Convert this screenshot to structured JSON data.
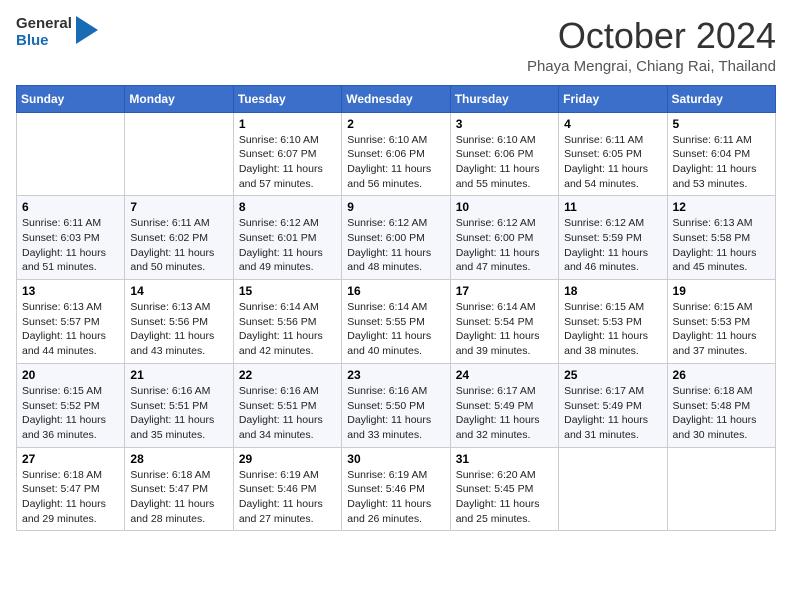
{
  "header": {
    "logo_general": "General",
    "logo_blue": "Blue",
    "month": "October 2024",
    "location": "Phaya Mengrai, Chiang Rai, Thailand"
  },
  "weekdays": [
    "Sunday",
    "Monday",
    "Tuesday",
    "Wednesday",
    "Thursday",
    "Friday",
    "Saturday"
  ],
  "weeks": [
    [
      {
        "day": "",
        "lines": []
      },
      {
        "day": "",
        "lines": []
      },
      {
        "day": "1",
        "lines": [
          "Sunrise: 6:10 AM",
          "Sunset: 6:07 PM",
          "Daylight: 11 hours",
          "and 57 minutes."
        ]
      },
      {
        "day": "2",
        "lines": [
          "Sunrise: 6:10 AM",
          "Sunset: 6:06 PM",
          "Daylight: 11 hours",
          "and 56 minutes."
        ]
      },
      {
        "day": "3",
        "lines": [
          "Sunrise: 6:10 AM",
          "Sunset: 6:06 PM",
          "Daylight: 11 hours",
          "and 55 minutes."
        ]
      },
      {
        "day": "4",
        "lines": [
          "Sunrise: 6:11 AM",
          "Sunset: 6:05 PM",
          "Daylight: 11 hours",
          "and 54 minutes."
        ]
      },
      {
        "day": "5",
        "lines": [
          "Sunrise: 6:11 AM",
          "Sunset: 6:04 PM",
          "Daylight: 11 hours",
          "and 53 minutes."
        ]
      }
    ],
    [
      {
        "day": "6",
        "lines": [
          "Sunrise: 6:11 AM",
          "Sunset: 6:03 PM",
          "Daylight: 11 hours",
          "and 51 minutes."
        ]
      },
      {
        "day": "7",
        "lines": [
          "Sunrise: 6:11 AM",
          "Sunset: 6:02 PM",
          "Daylight: 11 hours",
          "and 50 minutes."
        ]
      },
      {
        "day": "8",
        "lines": [
          "Sunrise: 6:12 AM",
          "Sunset: 6:01 PM",
          "Daylight: 11 hours",
          "and 49 minutes."
        ]
      },
      {
        "day": "9",
        "lines": [
          "Sunrise: 6:12 AM",
          "Sunset: 6:00 PM",
          "Daylight: 11 hours",
          "and 48 minutes."
        ]
      },
      {
        "day": "10",
        "lines": [
          "Sunrise: 6:12 AM",
          "Sunset: 6:00 PM",
          "Daylight: 11 hours",
          "and 47 minutes."
        ]
      },
      {
        "day": "11",
        "lines": [
          "Sunrise: 6:12 AM",
          "Sunset: 5:59 PM",
          "Daylight: 11 hours",
          "and 46 minutes."
        ]
      },
      {
        "day": "12",
        "lines": [
          "Sunrise: 6:13 AM",
          "Sunset: 5:58 PM",
          "Daylight: 11 hours",
          "and 45 minutes."
        ]
      }
    ],
    [
      {
        "day": "13",
        "lines": [
          "Sunrise: 6:13 AM",
          "Sunset: 5:57 PM",
          "Daylight: 11 hours",
          "and 44 minutes."
        ]
      },
      {
        "day": "14",
        "lines": [
          "Sunrise: 6:13 AM",
          "Sunset: 5:56 PM",
          "Daylight: 11 hours",
          "and 43 minutes."
        ]
      },
      {
        "day": "15",
        "lines": [
          "Sunrise: 6:14 AM",
          "Sunset: 5:56 PM",
          "Daylight: 11 hours",
          "and 42 minutes."
        ]
      },
      {
        "day": "16",
        "lines": [
          "Sunrise: 6:14 AM",
          "Sunset: 5:55 PM",
          "Daylight: 11 hours",
          "and 40 minutes."
        ]
      },
      {
        "day": "17",
        "lines": [
          "Sunrise: 6:14 AM",
          "Sunset: 5:54 PM",
          "Daylight: 11 hours",
          "and 39 minutes."
        ]
      },
      {
        "day": "18",
        "lines": [
          "Sunrise: 6:15 AM",
          "Sunset: 5:53 PM",
          "Daylight: 11 hours",
          "and 38 minutes."
        ]
      },
      {
        "day": "19",
        "lines": [
          "Sunrise: 6:15 AM",
          "Sunset: 5:53 PM",
          "Daylight: 11 hours",
          "and 37 minutes."
        ]
      }
    ],
    [
      {
        "day": "20",
        "lines": [
          "Sunrise: 6:15 AM",
          "Sunset: 5:52 PM",
          "Daylight: 11 hours",
          "and 36 minutes."
        ]
      },
      {
        "day": "21",
        "lines": [
          "Sunrise: 6:16 AM",
          "Sunset: 5:51 PM",
          "Daylight: 11 hours",
          "and 35 minutes."
        ]
      },
      {
        "day": "22",
        "lines": [
          "Sunrise: 6:16 AM",
          "Sunset: 5:51 PM",
          "Daylight: 11 hours",
          "and 34 minutes."
        ]
      },
      {
        "day": "23",
        "lines": [
          "Sunrise: 6:16 AM",
          "Sunset: 5:50 PM",
          "Daylight: 11 hours",
          "and 33 minutes."
        ]
      },
      {
        "day": "24",
        "lines": [
          "Sunrise: 6:17 AM",
          "Sunset: 5:49 PM",
          "Daylight: 11 hours",
          "and 32 minutes."
        ]
      },
      {
        "day": "25",
        "lines": [
          "Sunrise: 6:17 AM",
          "Sunset: 5:49 PM",
          "Daylight: 11 hours",
          "and 31 minutes."
        ]
      },
      {
        "day": "26",
        "lines": [
          "Sunrise: 6:18 AM",
          "Sunset: 5:48 PM",
          "Daylight: 11 hours",
          "and 30 minutes."
        ]
      }
    ],
    [
      {
        "day": "27",
        "lines": [
          "Sunrise: 6:18 AM",
          "Sunset: 5:47 PM",
          "Daylight: 11 hours",
          "and 29 minutes."
        ]
      },
      {
        "day": "28",
        "lines": [
          "Sunrise: 6:18 AM",
          "Sunset: 5:47 PM",
          "Daylight: 11 hours",
          "and 28 minutes."
        ]
      },
      {
        "day": "29",
        "lines": [
          "Sunrise: 6:19 AM",
          "Sunset: 5:46 PM",
          "Daylight: 11 hours",
          "and 27 minutes."
        ]
      },
      {
        "day": "30",
        "lines": [
          "Sunrise: 6:19 AM",
          "Sunset: 5:46 PM",
          "Daylight: 11 hours",
          "and 26 minutes."
        ]
      },
      {
        "day": "31",
        "lines": [
          "Sunrise: 6:20 AM",
          "Sunset: 5:45 PM",
          "Daylight: 11 hours",
          "and 25 minutes."
        ]
      },
      {
        "day": "",
        "lines": []
      },
      {
        "day": "",
        "lines": []
      }
    ]
  ]
}
